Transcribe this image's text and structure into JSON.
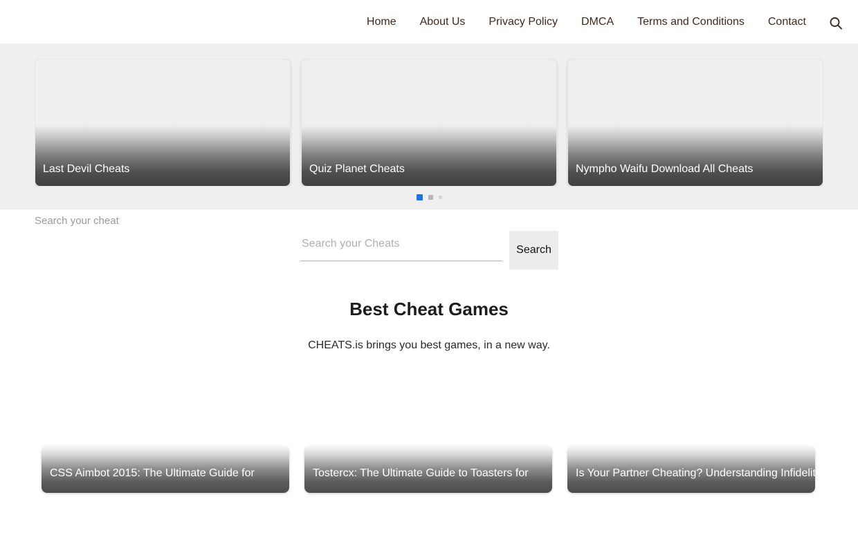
{
  "header": {
    "nav_items": [
      {
        "label": "Home"
      },
      {
        "label": "About Us"
      },
      {
        "label": "Privacy Policy"
      },
      {
        "label": "DMCA"
      },
      {
        "label": "Terms and Conditions"
      },
      {
        "label": "Contact"
      }
    ],
    "search_icon": "search-icon",
    "nav_color": "#3c2a21"
  },
  "carousel": {
    "slides": [
      {
        "title": "Last Devil Cheats"
      },
      {
        "title": "Quiz Planet Cheats"
      },
      {
        "title": "Nympho Waifu Download All Cheats"
      }
    ],
    "dots": [
      {
        "state": "active",
        "color": "#1a73e8"
      },
      {
        "state": "mid",
        "color": "#b7b7b7"
      },
      {
        "state": "small",
        "color": "#d4d4d4"
      }
    ],
    "background": "#efefef"
  },
  "search": {
    "heading": "Search your cheat",
    "placeholder": "Search your Cheats",
    "value": "",
    "submit_label": "Search"
  },
  "best_section": {
    "title": "Best Cheat Games",
    "subtitle": "CHEATS.is brings you best games, in a new way."
  },
  "games": {
    "cards": [
      {
        "title": "CSS Aimbot 2015: The Ultimate Guide for"
      },
      {
        "title": "Tostercx: The Ultimate Guide to Toasters for"
      },
      {
        "title": "Is Your Partner Cheating? Understanding Infidelity"
      }
    ]
  }
}
